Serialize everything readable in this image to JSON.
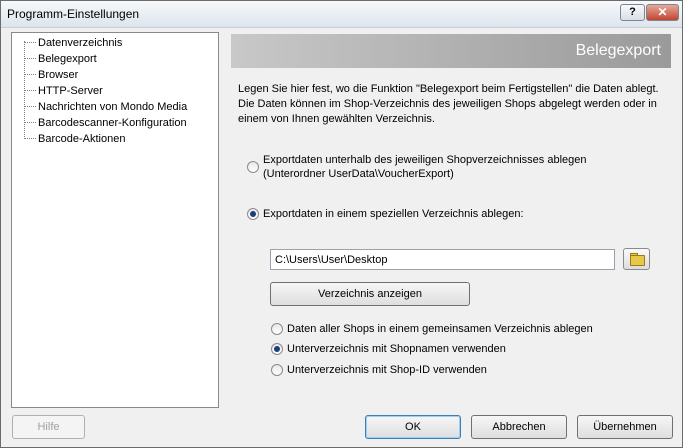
{
  "window": {
    "title": "Programm-Einstellungen",
    "help_glyph": "?",
    "close_glyph": "✕"
  },
  "tree": {
    "items": [
      {
        "label": "Datenverzeichnis"
      },
      {
        "label": "Belegexport"
      },
      {
        "label": "Browser"
      },
      {
        "label": "HTTP-Server"
      },
      {
        "label": "Nachrichten von Mondo Media"
      },
      {
        "label": "Barcodescanner-Konfiguration"
      },
      {
        "label": "Barcode-Aktionen"
      }
    ]
  },
  "panel": {
    "title": "Belegexport",
    "description": "Legen Sie hier fest, wo die Funktion \"Belegexport beim Fertigstellen\" die Daten ablegt. Die Daten können im Shop-Verzeichnis des jeweiligen Shops abgelegt werden oder in einem von Ihnen gewählten Verzeichnis.",
    "option_shop": {
      "line1": "Exportdaten unterhalb des jeweiligen Shopverzeichnisses ablegen",
      "line2": "(Unterordner UserData\\VoucherExport)",
      "checked": false
    },
    "option_special": {
      "label": "Exportdaten in einem speziellen Verzeichnis ablegen:",
      "checked": true
    },
    "directory": {
      "value": "C:\\Users\\User\\Desktop"
    },
    "show_dir_button": "Verzeichnis anzeigen",
    "sub_options": [
      {
        "label": "Daten aller Shops in einem gemeinsamen Verzeichnis ablegen",
        "checked": false
      },
      {
        "label": "Unterverzeichnis mit Shopnamen verwenden",
        "checked": true
      },
      {
        "label": "Unterverzeichnis mit Shop-ID verwenden",
        "checked": false
      }
    ]
  },
  "footer": {
    "help": "Hilfe",
    "ok": "OK",
    "cancel": "Abbrechen",
    "apply": "Übernehmen"
  },
  "icons": {
    "folder": "folder-open-icon"
  }
}
